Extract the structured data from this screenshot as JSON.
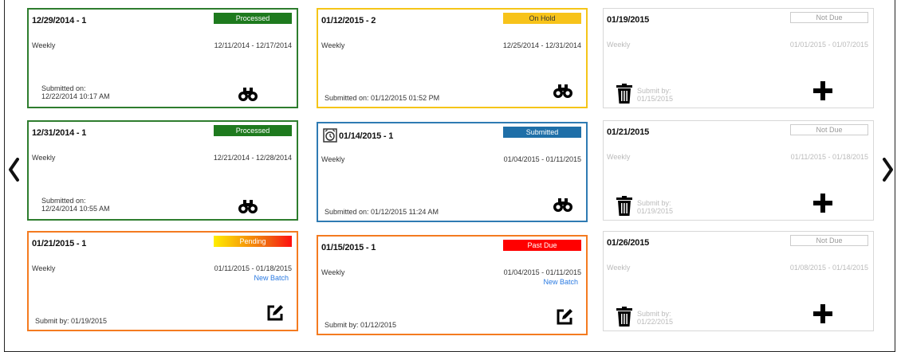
{
  "nav": {
    "prev_label": "previous",
    "next_label": "next"
  },
  "cards": [
    {
      "title": "12/29/2014 - 1",
      "status": "Processed",
      "frequency": "Weekly",
      "range": "12/11/2014 - 12/17/2014",
      "submitted_label": "Submitted on:",
      "submitted_value": "12/22/2014 10:17 AM"
    },
    {
      "title": "01/12/2015 - 2",
      "status": "On Hold",
      "frequency": "Weekly",
      "range": "12/25/2014 - 12/31/2014",
      "submitted_text": "Submitted on: 01/12/2015 01:52 PM"
    },
    {
      "title": "01/19/2015",
      "status": "Not Due",
      "frequency": "Weekly",
      "range": "01/01/2015 - 01/07/2015",
      "submitby_label": "Submit by:",
      "submitby_value": "01/15/2015"
    },
    {
      "title": "12/31/2014 - 1",
      "status": "Processed",
      "frequency": "Weekly",
      "range": "12/21/2014 - 12/28/2014",
      "submitted_label": "Submitted on:",
      "submitted_value": "12/24/2014 10:55 AM"
    },
    {
      "title": "01/14/2015 - 1",
      "status": "Submitted",
      "frequency": "Weekly",
      "range": "01/04/2015 - 01/11/2015",
      "submitted_text": "Submitted on: 01/12/2015 11:24 AM"
    },
    {
      "title": "01/21/2015",
      "status": "Not Due",
      "frequency": "Weekly",
      "range": "01/11/2015 - 01/18/2015",
      "submitby_label": "Submit by:",
      "submitby_value": "01/19/2015"
    },
    {
      "title": "01/21/2015 - 1",
      "status": "Pending",
      "frequency": "Weekly",
      "range": "01/11/2015 - 01/18/2015",
      "link": "New Batch",
      "submitby_text": "Submit by: 01/19/2015"
    },
    {
      "title": "01/15/2015 - 1",
      "status": "Past Due",
      "frequency": "Weekly",
      "range": "01/04/2015 - 01/11/2015",
      "link": "New Batch",
      "submitby_text": "Submit by: 01/12/2015"
    },
    {
      "title": "01/26/2015",
      "status": "Not Due",
      "frequency": "Weekly",
      "range": "01/08/2015 - 01/14/2015",
      "submitby_label": "Submit by:",
      "submitby_value": "01/22/2015"
    }
  ],
  "colors": {
    "processed": "#1e7a1e",
    "on_hold": "#f7c31a",
    "submitted": "#1f6fa8",
    "past_due": "#ff0000",
    "pending_start": "#ffee00",
    "pending_end": "#ff1010",
    "not_due_border": "#cccccc",
    "link": "#2a7ae2"
  },
  "icons": [
    "binoculars-icon",
    "edit-icon",
    "plus-icon",
    "trash-icon",
    "alarm-icon",
    "chevron-left-icon",
    "chevron-right-icon"
  ]
}
